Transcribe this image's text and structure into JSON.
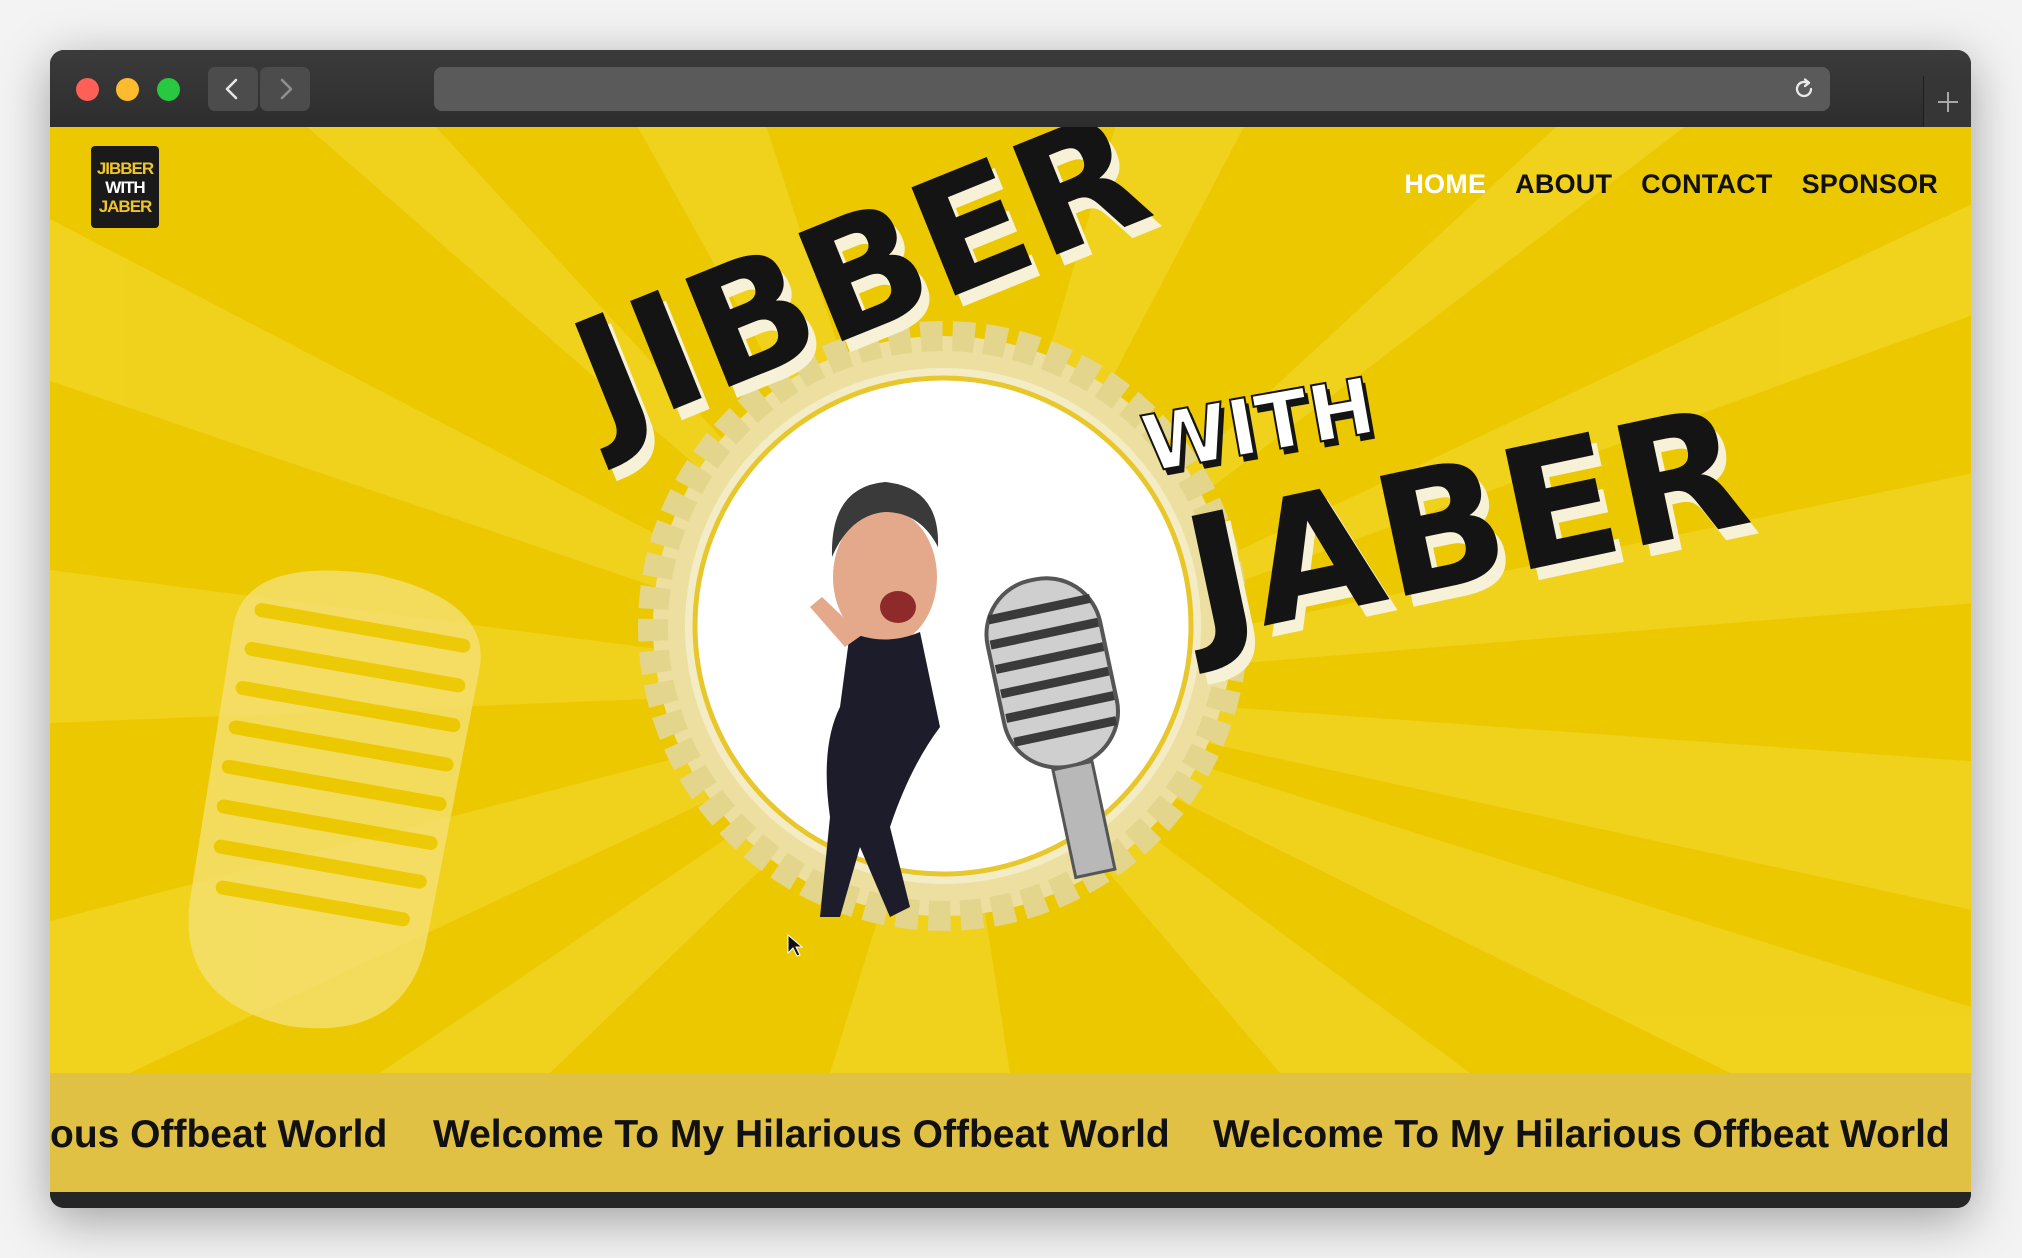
{
  "browser": {
    "traffic_lights": {
      "close": "#fe5f57",
      "minimize": "#febb2e",
      "maximize": "#28c840"
    },
    "back_icon": "chevron-left-icon",
    "forward_icon": "chevron-right-icon",
    "reload_icon": "reload-icon",
    "new_tab_icon": "plus-icon"
  },
  "site": {
    "logo": {
      "line1": "JIBBER",
      "line2": "WITH",
      "line3": "JABER"
    },
    "nav": [
      {
        "label": "HOME",
        "active": true
      },
      {
        "label": "ABOUT",
        "active": false
      },
      {
        "label": "CONTACT",
        "active": false
      },
      {
        "label": "SPONSOR",
        "active": false
      }
    ],
    "hero_title": {
      "line1": "JIBBER",
      "line2": "WITH",
      "line3": "JABER"
    },
    "ticker": {
      "partial": "ous Offbeat World",
      "text": "Welcome To My Hilarious Offbeat World"
    },
    "colors": {
      "hero": "#ecc800",
      "ticker": "#e1c143",
      "nav_active": "#ffffff",
      "nav_text": "#111111"
    }
  }
}
